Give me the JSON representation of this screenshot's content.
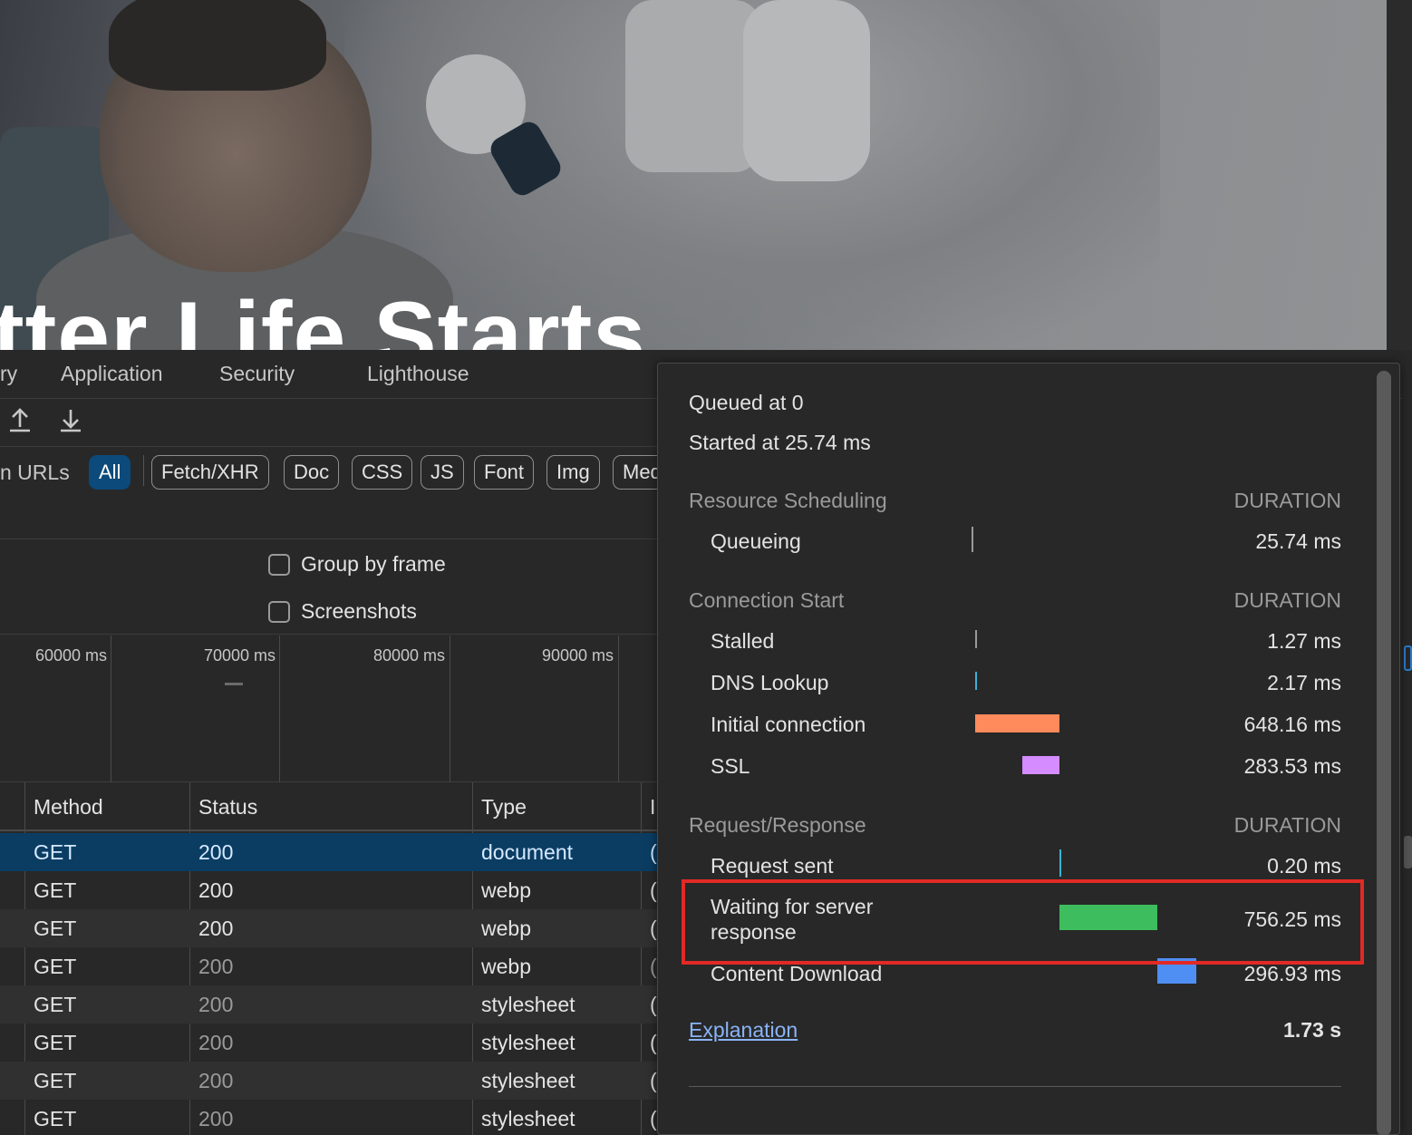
{
  "page": {
    "hero_text": "tter Life Starts"
  },
  "devtools": {
    "tabs": [
      "ry",
      "Application",
      "Security",
      "Lighthouse"
    ],
    "toolbar": {
      "upload_icon": "upload-icon",
      "download_icon": "download-icon"
    },
    "filter": {
      "label": "n URLs",
      "chips": [
        "All",
        "Fetch/XHR",
        "Doc",
        "CSS",
        "JS",
        "Font",
        "Img",
        "Med"
      ],
      "active": "All"
    },
    "settings": {
      "group_by_frame": "Group by frame",
      "screenshots": "Screenshots"
    },
    "timeline_labels": [
      "60000 ms",
      "70000 ms",
      "80000 ms",
      "90000 ms"
    ],
    "table": {
      "headers": [
        "Method",
        "Status",
        "Type",
        "I"
      ],
      "rows": [
        {
          "method": "GET",
          "status": "200",
          "type": "document",
          "extra": "("
        },
        {
          "method": "GET",
          "status": "200",
          "type": "webp",
          "extra": "("
        },
        {
          "method": "GET",
          "status": "200",
          "type": "webp",
          "extra": "("
        },
        {
          "method": "GET",
          "status": "200",
          "type": "webp",
          "extra": "("
        },
        {
          "method": "GET",
          "status": "200",
          "type": "stylesheet",
          "extra": "("
        },
        {
          "method": "GET",
          "status": "200",
          "type": "stylesheet",
          "extra": "("
        },
        {
          "method": "GET",
          "status": "200",
          "type": "stylesheet",
          "extra": "("
        },
        {
          "method": "GET",
          "status": "200",
          "type": "stylesheet",
          "extra": "("
        }
      ]
    }
  },
  "timing": {
    "queued": "Queued at 0",
    "started": "Started at 25.74 ms",
    "duration_header": "DURATION",
    "sections": {
      "resource_scheduling": "Resource Scheduling",
      "connection_start": "Connection Start",
      "request_response": "Request/Response"
    },
    "rows": {
      "queueing": {
        "label": "Queueing",
        "value": "25.74 ms"
      },
      "stalled": {
        "label": "Stalled",
        "value": "1.27 ms"
      },
      "dns": {
        "label": "DNS Lookup",
        "value": "2.17 ms"
      },
      "initial": {
        "label": "Initial connection",
        "value": "648.16 ms"
      },
      "ssl": {
        "label": "SSL",
        "value": "283.53 ms"
      },
      "request_sent": {
        "label": "Request sent",
        "value": "0.20 ms"
      },
      "waiting_1": "Waiting for server",
      "waiting_2": "response",
      "waiting_value": "756.25 ms",
      "download": {
        "label": "Content Download",
        "value": "296.93 ms"
      }
    },
    "explanation": "Explanation",
    "total": "1.73 s",
    "colors": {
      "initial": "#ff8a5b",
      "ssl": "#d48cff",
      "waiting": "#3dbd5d",
      "download": "#4f8ef2",
      "highlight": "#e12a26"
    }
  }
}
